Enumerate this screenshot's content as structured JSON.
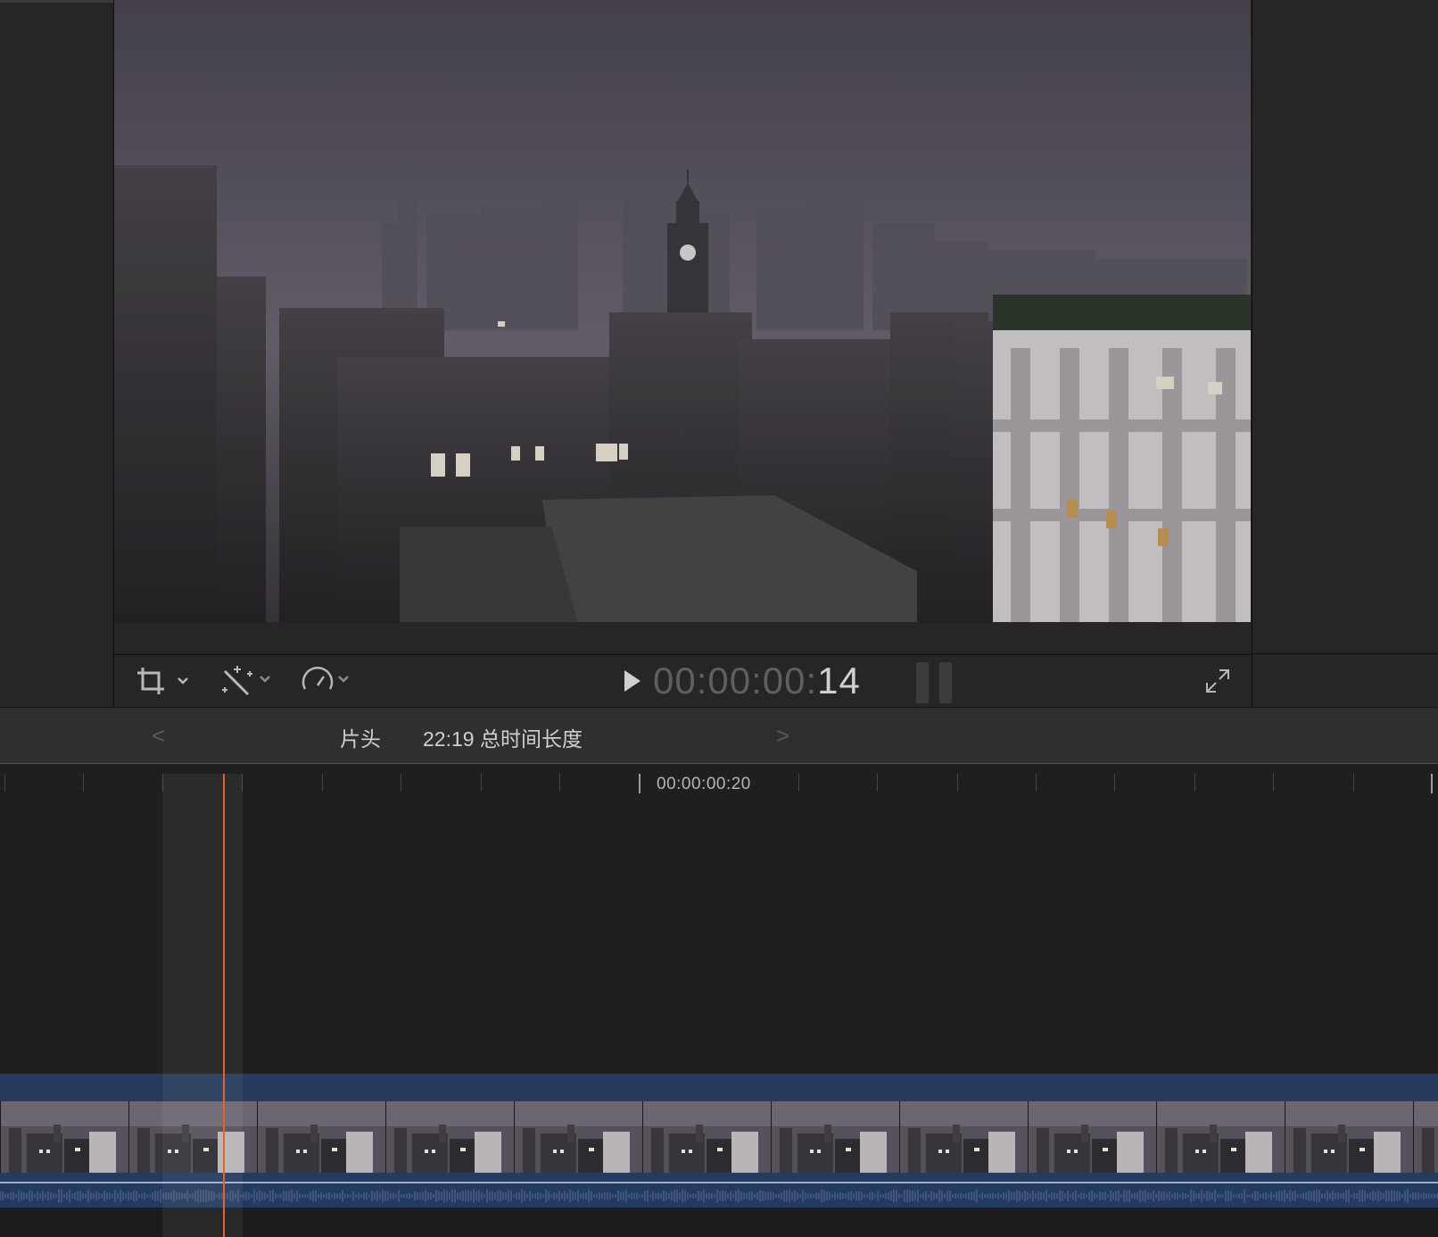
{
  "viewer": {
    "timecode_dim": "00:00:00:",
    "timecode_bright": "14"
  },
  "toolbar": {
    "crop_icon": "crop-icon",
    "enhance_icon": "magic-wand-icon",
    "speed_icon": "speedometer-icon",
    "play_icon": "play-icon",
    "fullscreen_icon": "fullscreen-icon"
  },
  "nav": {
    "prev": "<",
    "next": ">",
    "title": "片头",
    "duration": "22:19 总时间长度"
  },
  "timeline": {
    "ruler_label": "00:00:00:20"
  },
  "colors": {
    "playhead": "#e4622b",
    "clip_blue": "#253a5c",
    "selection_line": "#3c4fa6"
  }
}
